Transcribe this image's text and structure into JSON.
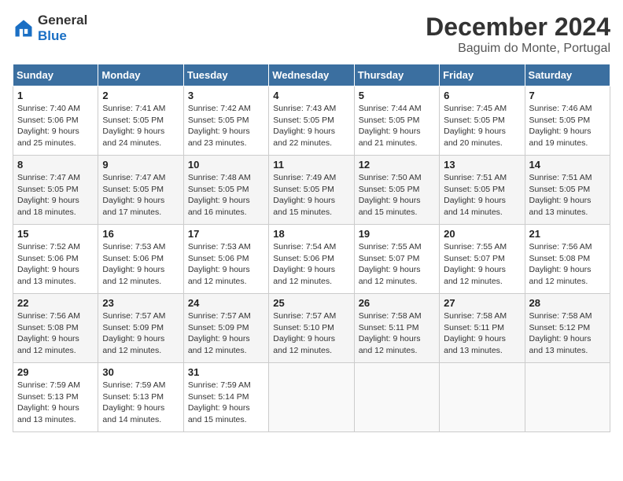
{
  "header": {
    "logo_line1": "General",
    "logo_line2": "Blue",
    "title": "December 2024",
    "subtitle": "Baguim do Monte, Portugal"
  },
  "weekdays": [
    "Sunday",
    "Monday",
    "Tuesday",
    "Wednesday",
    "Thursday",
    "Friday",
    "Saturday"
  ],
  "weeks": [
    [
      {
        "day": "1",
        "info": "Sunrise: 7:40 AM\nSunset: 5:06 PM\nDaylight: 9 hours\nand 25 minutes."
      },
      {
        "day": "2",
        "info": "Sunrise: 7:41 AM\nSunset: 5:05 PM\nDaylight: 9 hours\nand 24 minutes."
      },
      {
        "day": "3",
        "info": "Sunrise: 7:42 AM\nSunset: 5:05 PM\nDaylight: 9 hours\nand 23 minutes."
      },
      {
        "day": "4",
        "info": "Sunrise: 7:43 AM\nSunset: 5:05 PM\nDaylight: 9 hours\nand 22 minutes."
      },
      {
        "day": "5",
        "info": "Sunrise: 7:44 AM\nSunset: 5:05 PM\nDaylight: 9 hours\nand 21 minutes."
      },
      {
        "day": "6",
        "info": "Sunrise: 7:45 AM\nSunset: 5:05 PM\nDaylight: 9 hours\nand 20 minutes."
      },
      {
        "day": "7",
        "info": "Sunrise: 7:46 AM\nSunset: 5:05 PM\nDaylight: 9 hours\nand 19 minutes."
      }
    ],
    [
      {
        "day": "8",
        "info": "Sunrise: 7:47 AM\nSunset: 5:05 PM\nDaylight: 9 hours\nand 18 minutes."
      },
      {
        "day": "9",
        "info": "Sunrise: 7:47 AM\nSunset: 5:05 PM\nDaylight: 9 hours\nand 17 minutes."
      },
      {
        "day": "10",
        "info": "Sunrise: 7:48 AM\nSunset: 5:05 PM\nDaylight: 9 hours\nand 16 minutes."
      },
      {
        "day": "11",
        "info": "Sunrise: 7:49 AM\nSunset: 5:05 PM\nDaylight: 9 hours\nand 15 minutes."
      },
      {
        "day": "12",
        "info": "Sunrise: 7:50 AM\nSunset: 5:05 PM\nDaylight: 9 hours\nand 15 minutes."
      },
      {
        "day": "13",
        "info": "Sunrise: 7:51 AM\nSunset: 5:05 PM\nDaylight: 9 hours\nand 14 minutes."
      },
      {
        "day": "14",
        "info": "Sunrise: 7:51 AM\nSunset: 5:05 PM\nDaylight: 9 hours\nand 13 minutes."
      }
    ],
    [
      {
        "day": "15",
        "info": "Sunrise: 7:52 AM\nSunset: 5:06 PM\nDaylight: 9 hours\nand 13 minutes."
      },
      {
        "day": "16",
        "info": "Sunrise: 7:53 AM\nSunset: 5:06 PM\nDaylight: 9 hours\nand 12 minutes."
      },
      {
        "day": "17",
        "info": "Sunrise: 7:53 AM\nSunset: 5:06 PM\nDaylight: 9 hours\nand 12 minutes."
      },
      {
        "day": "18",
        "info": "Sunrise: 7:54 AM\nSunset: 5:06 PM\nDaylight: 9 hours\nand 12 minutes."
      },
      {
        "day": "19",
        "info": "Sunrise: 7:55 AM\nSunset: 5:07 PM\nDaylight: 9 hours\nand 12 minutes."
      },
      {
        "day": "20",
        "info": "Sunrise: 7:55 AM\nSunset: 5:07 PM\nDaylight: 9 hours\nand 12 minutes."
      },
      {
        "day": "21",
        "info": "Sunrise: 7:56 AM\nSunset: 5:08 PM\nDaylight: 9 hours\nand 12 minutes."
      }
    ],
    [
      {
        "day": "22",
        "info": "Sunrise: 7:56 AM\nSunset: 5:08 PM\nDaylight: 9 hours\nand 12 minutes."
      },
      {
        "day": "23",
        "info": "Sunrise: 7:57 AM\nSunset: 5:09 PM\nDaylight: 9 hours\nand 12 minutes."
      },
      {
        "day": "24",
        "info": "Sunrise: 7:57 AM\nSunset: 5:09 PM\nDaylight: 9 hours\nand 12 minutes."
      },
      {
        "day": "25",
        "info": "Sunrise: 7:57 AM\nSunset: 5:10 PM\nDaylight: 9 hours\nand 12 minutes."
      },
      {
        "day": "26",
        "info": "Sunrise: 7:58 AM\nSunset: 5:11 PM\nDaylight: 9 hours\nand 12 minutes."
      },
      {
        "day": "27",
        "info": "Sunrise: 7:58 AM\nSunset: 5:11 PM\nDaylight: 9 hours\nand 13 minutes."
      },
      {
        "day": "28",
        "info": "Sunrise: 7:58 AM\nSunset: 5:12 PM\nDaylight: 9 hours\nand 13 minutes."
      }
    ],
    [
      {
        "day": "29",
        "info": "Sunrise: 7:59 AM\nSunset: 5:13 PM\nDaylight: 9 hours\nand 13 minutes."
      },
      {
        "day": "30",
        "info": "Sunrise: 7:59 AM\nSunset: 5:13 PM\nDaylight: 9 hours\nand 14 minutes."
      },
      {
        "day": "31",
        "info": "Sunrise: 7:59 AM\nSunset: 5:14 PM\nDaylight: 9 hours\nand 15 minutes."
      },
      {
        "day": "",
        "info": ""
      },
      {
        "day": "",
        "info": ""
      },
      {
        "day": "",
        "info": ""
      },
      {
        "day": "",
        "info": ""
      }
    ]
  ]
}
